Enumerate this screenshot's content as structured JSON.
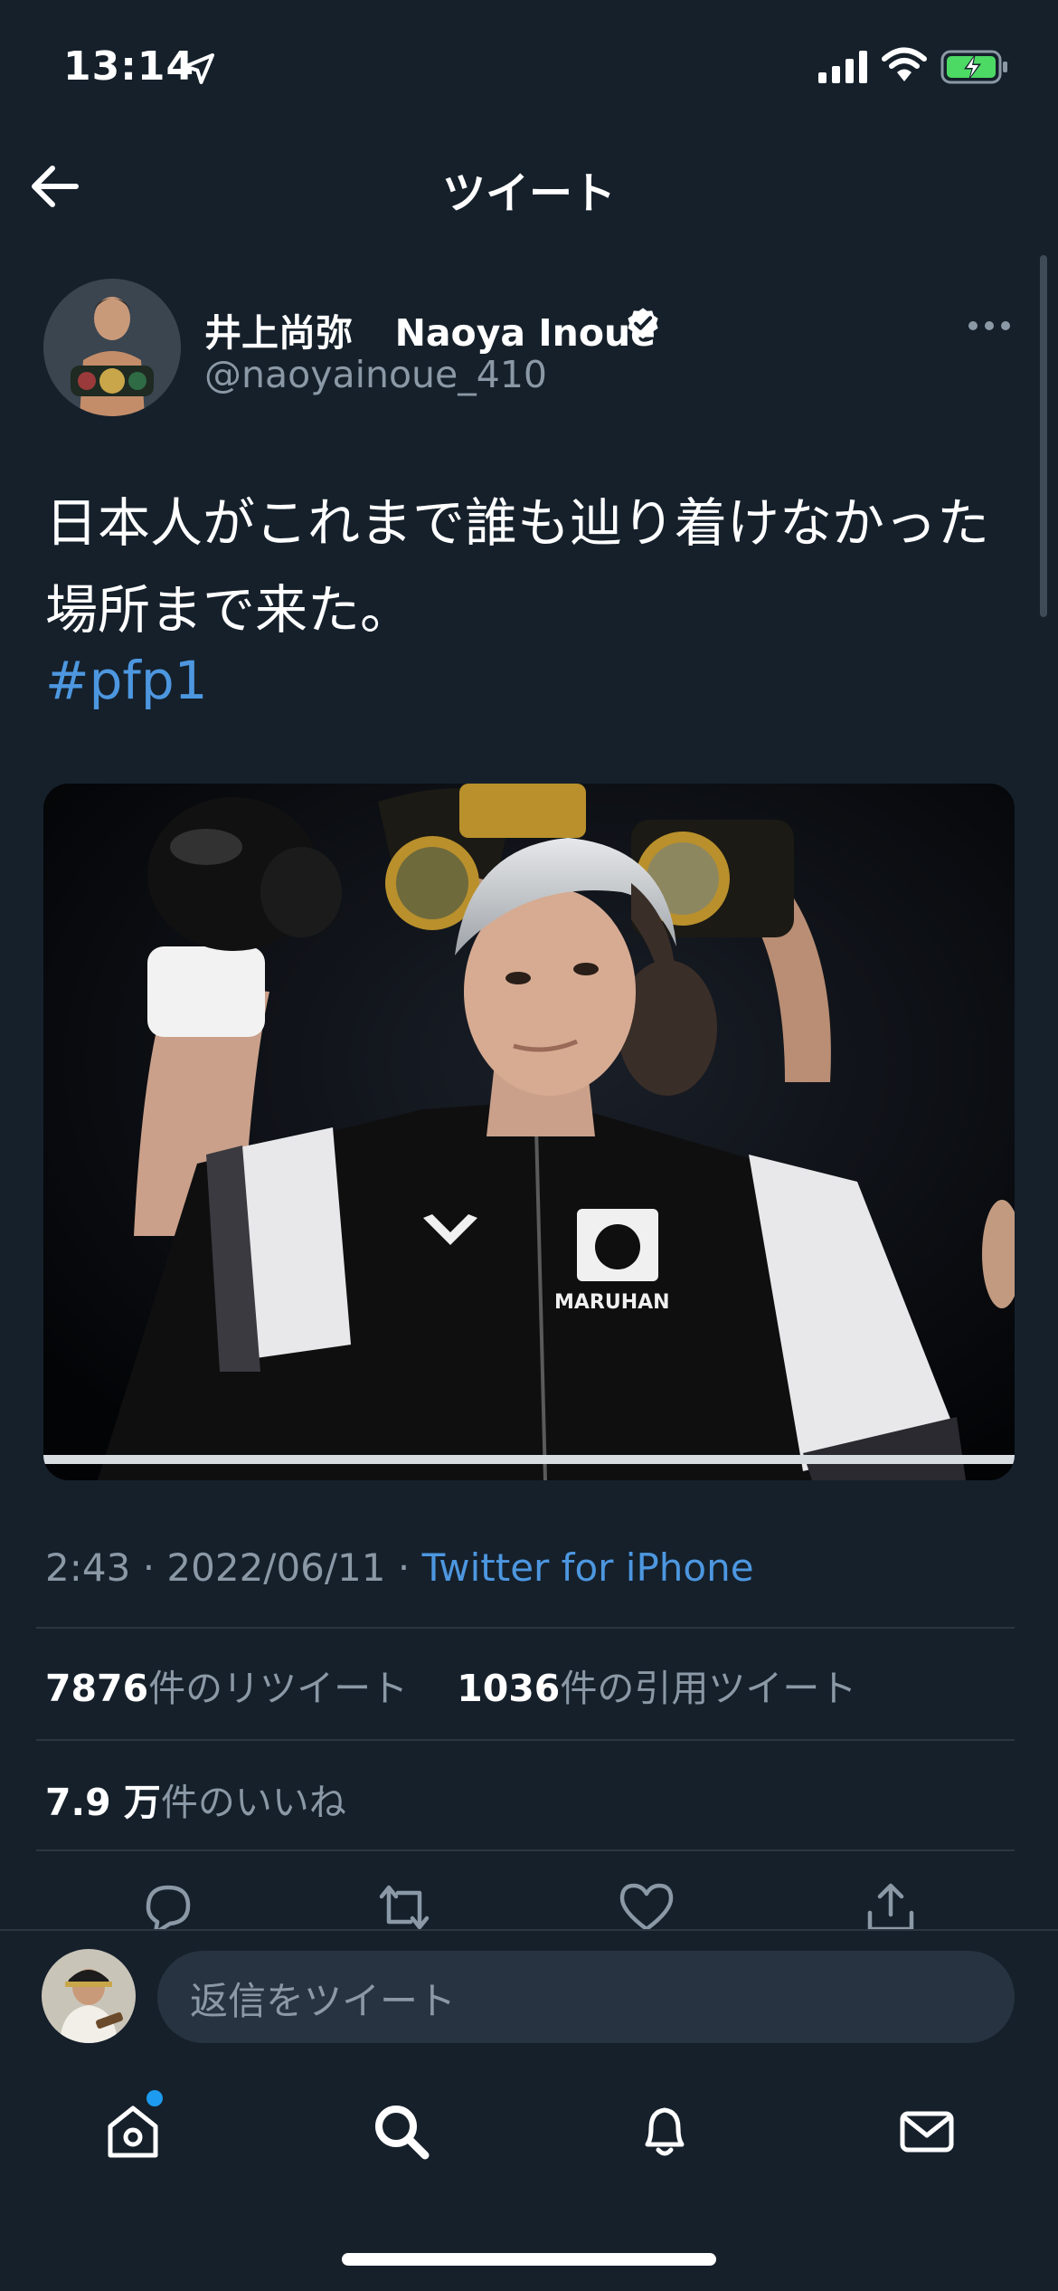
{
  "status_bar": {
    "time": "13:14"
  },
  "header": {
    "title": "ツイート"
  },
  "author": {
    "name_jp": "井上尚弥",
    "name_en": "Naoya Inoue",
    "handle": "@naoyainoue_410"
  },
  "tweet": {
    "text": "日本人がこれまで誰も辿り着けなかった場所まで来た。",
    "hashtag": "#pfp1",
    "photo_text": "MARUHAN"
  },
  "meta": {
    "time": "2:43",
    "separator": "·",
    "date": "2022/06/11",
    "source": "Twitter for iPhone"
  },
  "stats": {
    "retweets": "7876",
    "retweets_label": "件のリツイート",
    "quotes": "1036",
    "quotes_label": "件の引用ツイート",
    "likes": "7.9 万",
    "likes_label": "件のいいね"
  },
  "reply": {
    "placeholder": "返信をツイート"
  },
  "icons": {
    "back": "arrow-left-icon",
    "more": "more-horizontal-icon",
    "verified": "verified-badge-icon",
    "actions": [
      "reply-icon",
      "retweet-icon",
      "like-icon",
      "share-icon"
    ],
    "tabs": [
      "home-icon",
      "search-icon",
      "notifications-icon",
      "messages-icon"
    ]
  },
  "colors": {
    "background": "#15202b",
    "accent": "#4d97e0",
    "secondary_text": "#8b98a5",
    "battery_green": "#4cd964"
  }
}
